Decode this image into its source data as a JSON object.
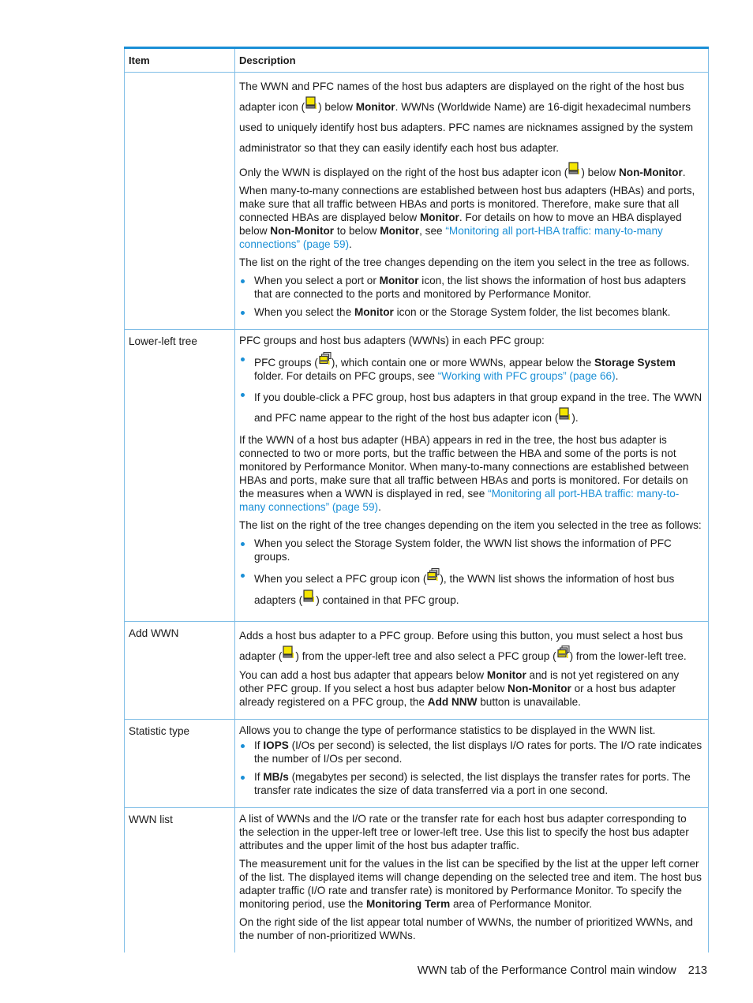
{
  "table": {
    "headers": [
      "Item",
      "Description"
    ],
    "rows": [
      {
        "item": "",
        "paragraphs": {
          "p1a": "The WWN and PFC names of the host bus adapters are displayed on the right of the host bus adapter icon (",
          "p1b": ") below ",
          "p1c": "Monitor",
          "p1d": ". WWNs (Worldwide Name) are 16-digit hexadecimal numbers used to uniquely identify host bus adapters. PFC names are nicknames assigned by the system administrator so that they can easily identify each host bus adapter.",
          "p2a": "Only the WWN is displayed on the right of the host bus adapter icon (",
          "p2b": ") below ",
          "p2c": "Non-Monitor",
          "p2d": ".",
          "p3a": "When many-to-many connections are established between host bus adapters (HBAs) and ports, make sure that all traffic between HBAs and ports is monitored. Therefore, make sure that all connected HBAs are displayed below ",
          "p3b": "Monitor",
          "p3c": ". For details on how to move an HBA displayed below ",
          "p3d": "Non-Monitor",
          "p3e": " to below ",
          "p3f": "Monitor",
          "p3g": ", see ",
          "p3link": "“Monitoring all port-HBA traffic: many-to-many connections” (page 59)",
          "p3h": ".",
          "p4": "The list on the right of the tree changes depending on the item you select in the tree as follows.",
          "b1a": "When you select a port or ",
          "b1b": "Monitor",
          "b1c": " icon, the list shows the information of host bus adapters that are connected to the ports and monitored by Performance Monitor.",
          "b2a": "When you select the ",
          "b2b": "Monitor",
          "b2c": " icon or the Storage System folder, the list becomes blank."
        }
      },
      {
        "item": "Lower-left tree",
        "paragraphs": {
          "p1": "PFC groups and host bus adapters (WWNs) in each PFC group:",
          "b1a": "PFC groups (",
          "b1b": "), which contain one or more WWNs, appear below the ",
          "b1c": "Storage System",
          "b1d": " folder. For details on PFC groups, see ",
          "b1link": "“Working with PFC groups” (page 66)",
          "b1e": ".",
          "b2a": "If you double-click a PFC group, host bus adapters in that group expand in the tree. The WWN and PFC name appear to the right of the host bus adapter icon (",
          "b2b": ").",
          "p2a": "If the WWN of a host bus adapter (HBA) appears in red in the tree, the host bus adapter is connected to two or more ports, but the traffic between the HBA and some of the ports is not monitored by Performance Monitor. When many-to-many connections are established between HBAs and ports, make sure that all traffic between HBAs and ports is monitored. For details on the measures when a WWN is displayed in red, see ",
          "p2link": "“Monitoring all port-HBA traffic: many-to-many connections” (page 59)",
          "p2b": ".",
          "p3": "The list on the right of the tree changes depending on the item you selected in the tree as follows:",
          "b3": "When you select the Storage System folder, the WWN list shows the information of PFC groups.",
          "b4a": "When you select a PFC group icon (",
          "b4b": "), the WWN list shows the information of host bus adapters (",
          "b4c": ") contained in that PFC group."
        }
      },
      {
        "item": "Add WWN",
        "paragraphs": {
          "p1a": "Adds a host bus adapter to a PFC group. Before using this button, you must select a host bus adapter (",
          "p1b": ") from the upper-left tree and also select a PFC group (",
          "p1c": ") from the lower-left tree.",
          "p2a": "You can add a host bus adapter that appears below ",
          "p2b": "Monitor",
          "p2c": " and is not yet registered on any other PFC group. If you select a host bus adapter below ",
          "p2d": "Non-Monitor",
          "p2e": " or a host bus adapter already registered on a PFC group, the ",
          "p2f": "Add NNW",
          "p2g": " button is unavailable."
        }
      },
      {
        "item": "Statistic type",
        "paragraphs": {
          "p1": "Allows you to change the type of performance statistics to be displayed in the WWN list.",
          "b1a": "If ",
          "b1b": "IOPS",
          "b1c": " (I/Os per second) is selected, the list displays I/O rates for ports. The I/O rate indicates the number of I/Os per second.",
          "b2a": "If ",
          "b2b": "MB/s",
          "b2c": " (megabytes per second) is selected, the list displays the transfer rates for ports. The transfer rate indicates the size of data transferred via a port in one second."
        }
      },
      {
        "item": "WWN list",
        "paragraphs": {
          "p1": "A list of WWNs and the I/O rate or the transfer rate for each host bus adapter corresponding to the selection in the upper-left tree or lower-left tree. Use this list to specify the host bus adapter attributes and the upper limit of the host bus adapter traffic.",
          "p2a": "The measurement unit for the values in the list can be specified by the list at the upper left corner of the list. The displayed items will change depending on the selected tree and item. The host bus adapter traffic (I/O rate and transfer rate) is monitored by Performance Monitor. To specify the monitoring period, use the ",
          "p2b": "Monitoring Term",
          "p2c": " area of Performance Monitor.",
          "p3": "On the right side of the list appear total number of WWNs, the number of prioritized WWNs, and the number of non-prioritized WWNs."
        }
      }
    ]
  },
  "icons": {
    "hba": "host-bus-adapter-icon",
    "pfc_group": "pfc-group-icon"
  },
  "colors": {
    "accent": "#1a8fd6",
    "link": "#1a8fd6",
    "border": "#7fbde6",
    "icon_yellow": "#f5e600"
  },
  "footer": {
    "section_title": "WWN tab of the Performance Control main window",
    "page_number": "213"
  }
}
